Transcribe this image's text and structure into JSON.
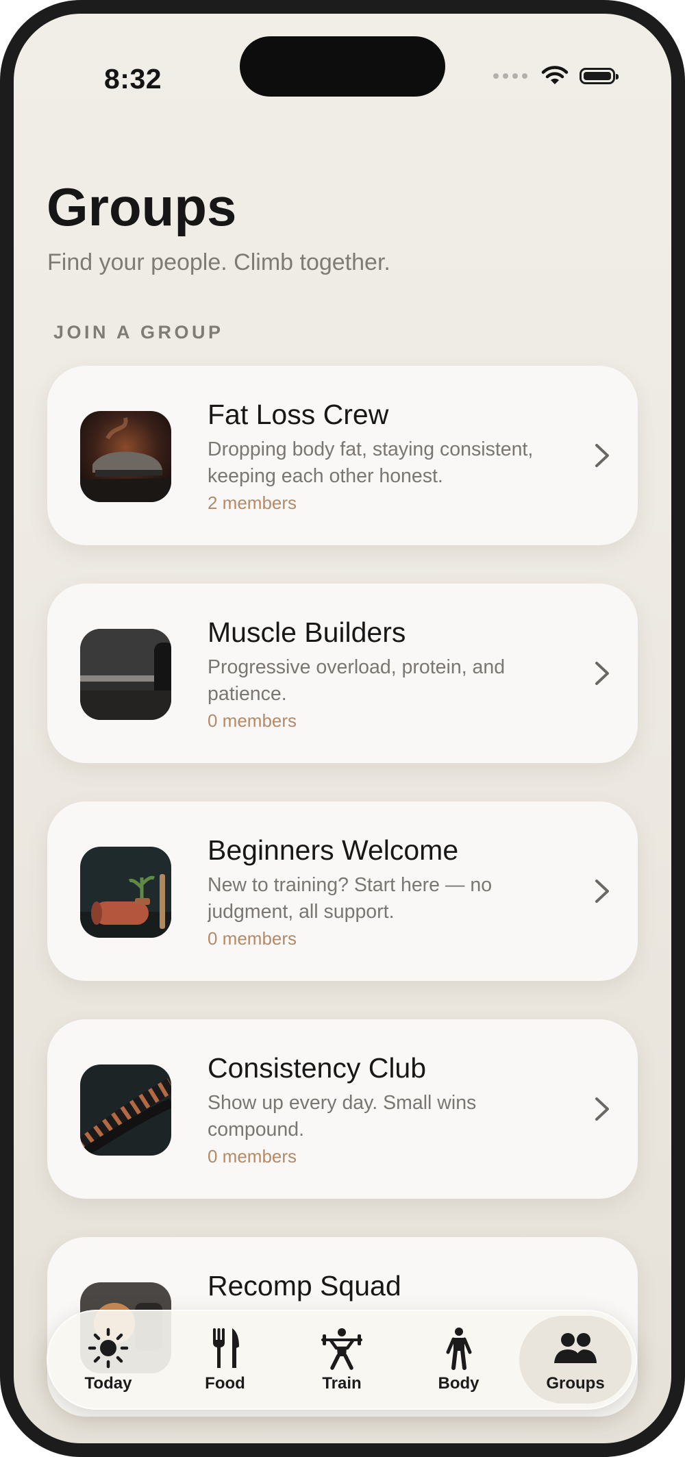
{
  "status_bar": {
    "time": "8:32"
  },
  "header": {
    "title": "Groups",
    "subtitle": "Find your people. Climb together."
  },
  "section": {
    "label": "JOIN A GROUP"
  },
  "groups": [
    {
      "title": "Fat Loss Crew",
      "description": "Dropping body fat, staying consistent, keeping each other honest.",
      "members": "2 members",
      "image": "smoking-sneakers-photo"
    },
    {
      "title": "Muscle Builders",
      "description": "Progressive overload, protein, and patience.",
      "members": "0 members",
      "image": "barbell-photo"
    },
    {
      "title": "Beginners Welcome",
      "description": "New to training? Start here — no judgment, all support.",
      "members": "0 members",
      "image": "yoga-mat-plant-photo"
    },
    {
      "title": "Consistency Club",
      "description": "Show up every day. Small wins compound.",
      "members": "0 members",
      "image": "battle-ropes-photo"
    },
    {
      "title": "Recomp Squad",
      "description": "",
      "members": "",
      "image": "weights-photo"
    }
  ],
  "tabs": [
    {
      "label": "Today",
      "icon": "sun-icon",
      "active": false
    },
    {
      "label": "Food",
      "icon": "fork-knife-icon",
      "active": false
    },
    {
      "label": "Train",
      "icon": "weightlifter-icon",
      "active": false
    },
    {
      "label": "Body",
      "icon": "person-icon",
      "active": false
    },
    {
      "label": "Groups",
      "icon": "people-icon",
      "active": true
    }
  ],
  "colors": {
    "background": "#efebe5",
    "card": "#f9f8f6",
    "accent_members": "#b38a69",
    "text_primary": "#171717",
    "text_secondary": "#7a7672"
  }
}
